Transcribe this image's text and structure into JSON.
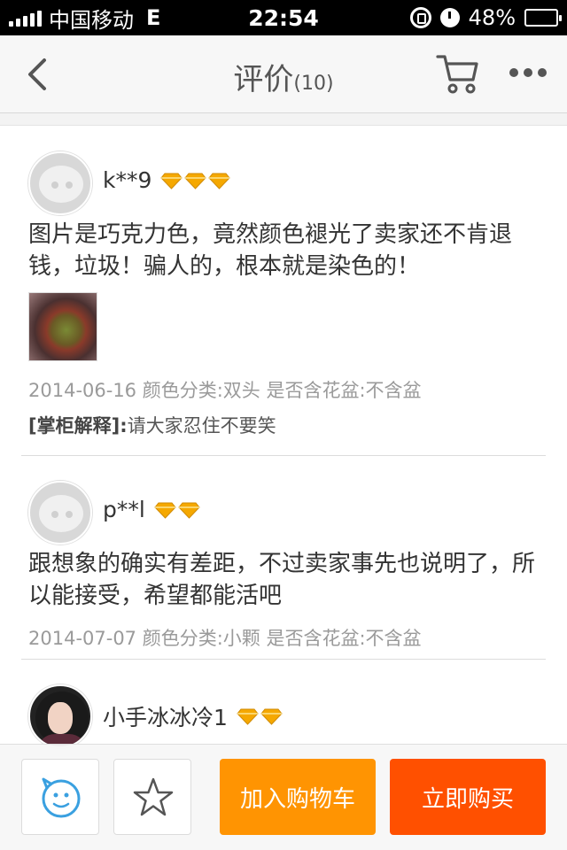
{
  "status_bar": {
    "carrier": "中国移动",
    "network": "E",
    "time": "22:54",
    "battery": "48%",
    "battery_level": 0.48
  },
  "nav": {
    "title": "评价",
    "count": "(10)",
    "icons": [
      "back-icon",
      "cart-icon",
      "more-icon"
    ]
  },
  "reviews": [
    {
      "user": "k**9",
      "gems": 3,
      "text": "图片是巧克力色，竟然颜色褪光了卖家还不肯退钱，垃圾！骗人的，根本就是染色的！",
      "meta": "2014-06-16 颜色分类:双头 是否含花盆:不含盆",
      "reply_label": "[掌柜解释]:",
      "reply_text": "请大家忍住不要笑"
    },
    {
      "user": "p**l",
      "gems": 2,
      "text": "跟想象的确实有差距，不过卖家事先也说明了，所以能接受，希望都能活吧",
      "meta": "2014-07-07 颜色分类:小颗 是否含花盆:不含盆"
    },
    {
      "user": "小手冰冰冷1",
      "gems": 2
    }
  ],
  "bottom_bar": {
    "add_to_cart": "加入购物车",
    "buy_now": "立即购买",
    "icons": [
      "service-icon",
      "star-icon"
    ]
  },
  "colors": {
    "cart_button": "#ff9402",
    "buy_button": "#ff5000",
    "gem": "#f5a800"
  }
}
